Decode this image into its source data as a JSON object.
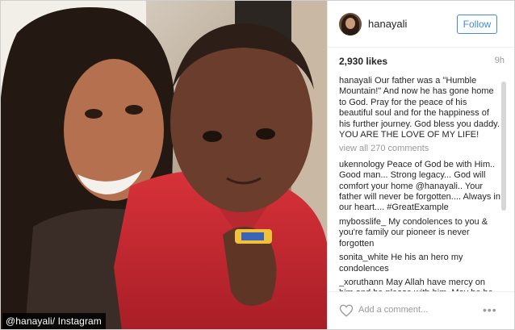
{
  "photo": {
    "watermark": "@hanayali/ Instagram"
  },
  "header": {
    "username": "hanayali",
    "follow_label": "Follow"
  },
  "stats": {
    "likes": "2,930 likes",
    "age": "9h"
  },
  "caption": {
    "user": "hanayali",
    "text": "Our father was a \"Humble Mountain!\" And now he has gone home to God. Pray for the peace of his beautiful soul and for the happiness of his further journey. God bless you daddy. YOU ARE THE LOVE OF MY LIFE!"
  },
  "view_all": "view all 270 comments",
  "comments": [
    {
      "user": "ukennology",
      "text": "Peace of God be with Him.. Good man... Strong legacy... God will comfort your home @hanayali.. Your father will never be forgotten.... Always in our heart.... #GreatExample"
    },
    {
      "user": "mybosslife_",
      "text": "My condolences to you & you're family our pioneer is never forgotten"
    },
    {
      "user": "sonita_white",
      "text": "He his an hero my condolences"
    },
    {
      "user": "_xoruthann",
      "text": "May Allah have mercy on him and be please with him. May he be granted the highest spot for where he's"
    }
  ],
  "footer": {
    "add_comment_placeholder": "Add a comment...",
    "more_label": "•••"
  },
  "colors": {
    "accent": "#3f8bd8",
    "muted": "#999999"
  },
  "icons": {
    "heart": "heart-icon",
    "more": "more-options-icon"
  }
}
